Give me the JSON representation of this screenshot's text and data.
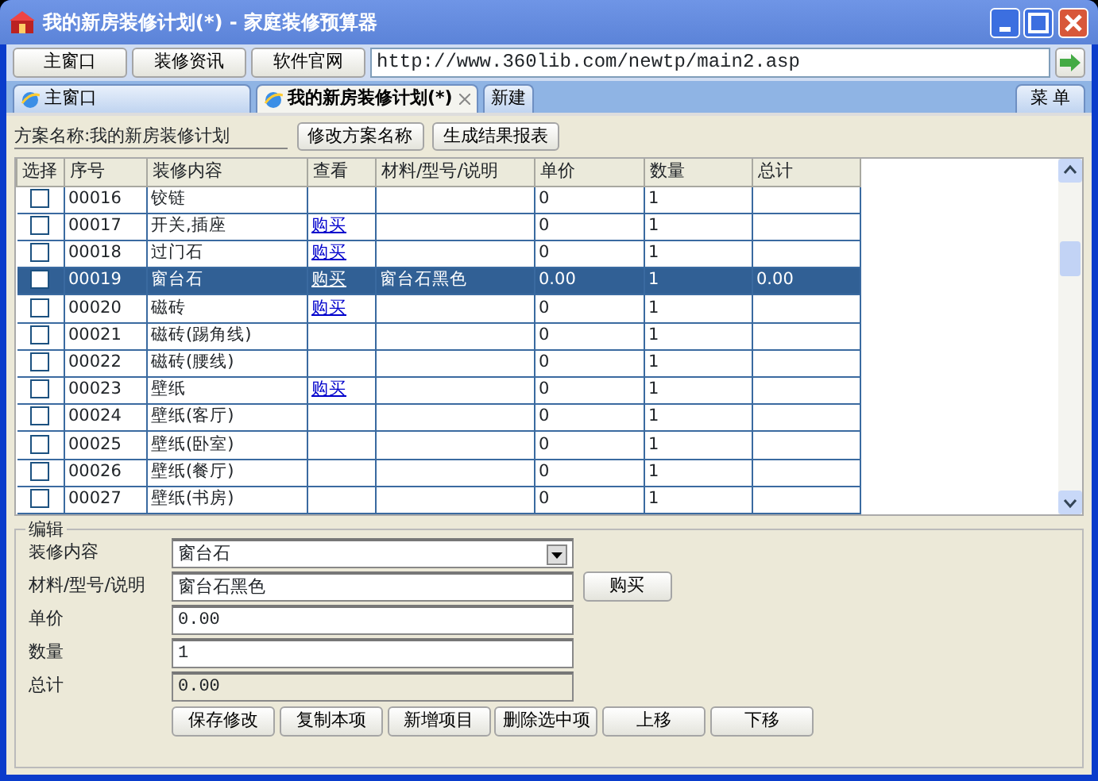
{
  "window": {
    "title": "我的新房装修计划(*) - 家庭装修预算器"
  },
  "toolbar": {
    "buttons": [
      "主窗口",
      "装修资讯",
      "软件官网"
    ],
    "address": "http://www.360lib.com/newtp/main2.asp"
  },
  "tabs": [
    {
      "label": "主窗口",
      "selected": false,
      "kind": "page"
    },
    {
      "label": "我的新房装修计划(*)",
      "selected": true,
      "kind": "page"
    },
    {
      "label": "新建",
      "selected": false,
      "kind": "new"
    }
  ],
  "menu_button": "菜 单",
  "plan": {
    "name": "方案名称:我的新房装修计划",
    "buttons": [
      "修改方案名称",
      "生成结果报表"
    ]
  },
  "table": {
    "columns": [
      "选择",
      "序号",
      "装修内容",
      "查看",
      "材料/型号/说明",
      "单价",
      "数量",
      "总计"
    ],
    "rows": [
      {
        "selected": false,
        "checked": false,
        "cells": [
          "",
          "00016",
          "铰链",
          "",
          "",
          "0",
          "1",
          ""
        ]
      },
      {
        "selected": false,
        "checked": false,
        "cells": [
          "",
          "00017",
          "开关,插座",
          "购买",
          "",
          "0",
          "1",
          ""
        ]
      },
      {
        "selected": false,
        "checked": false,
        "cells": [
          "",
          "00018",
          "过门石",
          "购买",
          "",
          "0",
          "1",
          ""
        ]
      },
      {
        "selected": true,
        "checked": false,
        "cells": [
          "",
          "00019",
          "窗台石",
          "购买",
          "窗台石黑色",
          "0.00",
          "1",
          "0.00"
        ]
      },
      {
        "selected": false,
        "checked": false,
        "cells": [
          "",
          "00020",
          "磁砖",
          "购买",
          "",
          "0",
          "1",
          ""
        ]
      },
      {
        "selected": false,
        "checked": false,
        "cells": [
          "",
          "00021",
          "磁砖(踢角线)",
          "",
          "",
          "0",
          "1",
          ""
        ]
      },
      {
        "selected": false,
        "checked": false,
        "cells": [
          "",
          "00022",
          "磁砖(腰线)",
          "",
          "",
          "0",
          "1",
          ""
        ]
      },
      {
        "selected": false,
        "checked": false,
        "cells": [
          "",
          "00023",
          "壁纸",
          "购买",
          "",
          "0",
          "1",
          ""
        ]
      },
      {
        "selected": false,
        "checked": false,
        "cells": [
          "",
          "00024",
          "壁纸(客厅)",
          "",
          "",
          "0",
          "1",
          ""
        ]
      },
      {
        "selected": false,
        "checked": false,
        "cells": [
          "",
          "00025",
          "壁纸(卧室)",
          "",
          "",
          "0",
          "1",
          ""
        ]
      },
      {
        "selected": false,
        "checked": false,
        "cells": [
          "",
          "00026",
          "壁纸(餐厅)",
          "",
          "",
          "0",
          "1",
          ""
        ]
      },
      {
        "selected": false,
        "checked": false,
        "cells": [
          "",
          "00027",
          "壁纸(书房)",
          "",
          "",
          "0",
          "1",
          ""
        ]
      }
    ]
  },
  "edit": {
    "legend": "编辑",
    "fields": [
      {
        "kind": "select",
        "label": "装修内容",
        "value": "窗台石"
      },
      {
        "kind": "input",
        "label": "材料/型号/说明",
        "value": "窗台石黑色",
        "button": "购买"
      },
      {
        "kind": "input",
        "label": "单价",
        "value": "0.00"
      },
      {
        "kind": "input",
        "label": "数量",
        "value": "1"
      },
      {
        "kind": "readonly",
        "label": "总计",
        "value": "0.00"
      }
    ],
    "buttons": [
      "保存修改",
      "复制本项",
      "新增项目",
      "删除选中项",
      "上移",
      "下移"
    ]
  }
}
